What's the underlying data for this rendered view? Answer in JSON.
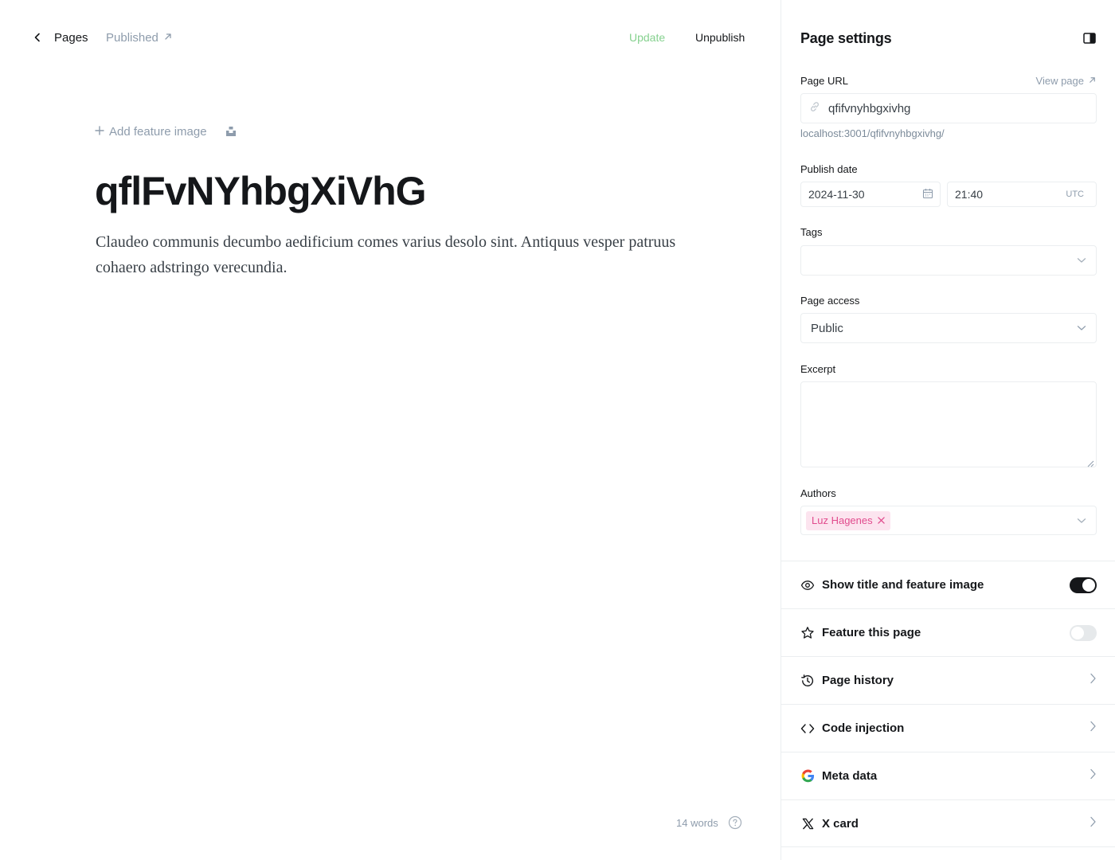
{
  "editor": {
    "back_label": "Pages",
    "status_label": "Published",
    "update_label": "Update",
    "unpublish_label": "Unpublish",
    "add_feature_label": "Add feature image",
    "title": "qflFvNYhbgXiVhG",
    "body": "Claudeo communis decumbo aedificium comes varius desolo sint. Antiquus vesper patruus cohaero adstringo verecundia.",
    "word_count": "14 words"
  },
  "settings": {
    "title": "Page settings",
    "url_label": "Page URL",
    "view_page_label": "View page",
    "url_value": "qfifvnyhbgxivhg",
    "url_hint": "localhost:3001/qfifvnyhbgxivhg/",
    "publish_date_label": "Publish date",
    "date_value": "2024-11-30",
    "time_value": "21:40",
    "timezone": "UTC",
    "tags_label": "Tags",
    "tags_value": "",
    "access_label": "Page access",
    "access_value": "Public",
    "excerpt_label": "Excerpt",
    "excerpt_value": "",
    "authors_label": "Authors",
    "authors": [
      "Luz Hagenes"
    ],
    "rows": {
      "show_title": {
        "label": "Show title and feature image",
        "on": true
      },
      "feature": {
        "label": "Feature this page",
        "on": false
      },
      "history": {
        "label": "Page history"
      },
      "code_injection": {
        "label": "Code injection"
      },
      "meta_data": {
        "label": "Meta data"
      },
      "x_card": {
        "label": "X card"
      }
    }
  },
  "colors": {
    "accent_green": "#86d18f",
    "text_dark": "#15171a",
    "muted": "#8e9cac",
    "border": "#ebeef0",
    "author_tag_bg": "#fce4ef",
    "author_tag_text": "#e14b8d"
  },
  "icons": {
    "back": "chevron-left-icon",
    "external": "arrow-up-right-icon",
    "plus": "plus-icon",
    "unsplash": "unsplash-icon",
    "panel_toggle": "sidebar-right-icon",
    "link": "link-icon",
    "calendar": "calendar-icon",
    "chevron_down": "chevron-down-icon",
    "close": "close-icon",
    "eye": "eye-icon",
    "star": "star-icon",
    "history": "history-icon",
    "code": "code-icon",
    "google": "google-icon",
    "x": "x-logo-icon",
    "chevron_right": "chevron-right-icon",
    "help": "help-circle-icon"
  }
}
